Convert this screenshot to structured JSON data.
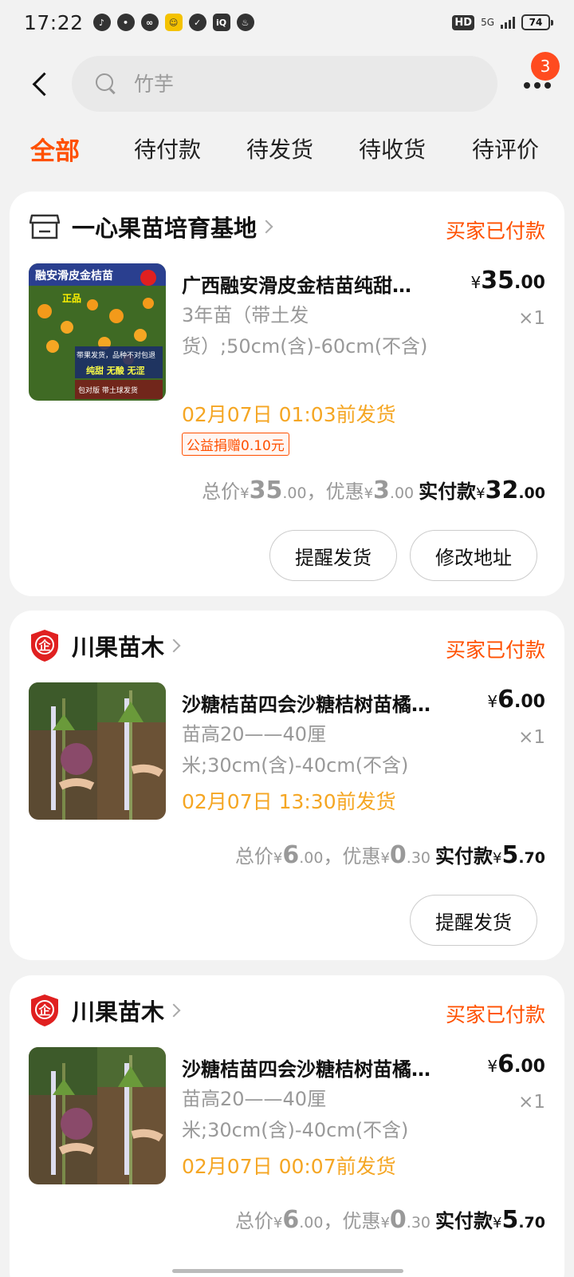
{
  "status_bar": {
    "time": "17:22",
    "hd": "HD",
    "network": "5G",
    "battery": "74"
  },
  "search": {
    "placeholder": "竹芋"
  },
  "more_badge": "3",
  "tabs": [
    "全部",
    "待付款",
    "待发货",
    "待收货",
    "待评价"
  ],
  "active_tab": "全部",
  "orders": [
    {
      "shop": "一心果苗培育基地",
      "status": "买家已付款",
      "title": "广西融安滑皮金桔苗纯甜…",
      "price_int": "35",
      "price_dec": ".00",
      "qty": "×1",
      "spec": "3年苗（带土发货）;50cm(含)-60cm(不含)",
      "ship": "02月07日 01:03前发货",
      "tag": "公益捐赠0.10元",
      "sum_total_label": "总价",
      "sum_total_int": "35",
      "sum_total_dec": ".00",
      "sum_discount_label": "，优惠",
      "sum_discount_int": "3",
      "sum_discount_dec": ".00",
      "sum_paid_label": "实付款",
      "sum_paid_int": "32",
      "sum_paid_dec": ".00",
      "buttons": [
        "提醒发货",
        "修改地址"
      ]
    },
    {
      "shop": "川果苗木",
      "status": "买家已付款",
      "title": "沙糖桔苗四会沙糖桔树苗橘…",
      "price_int": "6",
      "price_dec": ".00",
      "qty": "×1",
      "spec": "苗高20——40厘米;30cm(含)-40cm(不含)",
      "ship": "02月07日 13:30前发货",
      "sum_total_label": "总价",
      "sum_total_int": "6",
      "sum_total_dec": ".00",
      "sum_discount_label": "，优惠",
      "sum_discount_int": "0",
      "sum_discount_dec": ".30",
      "sum_paid_label": "实付款",
      "sum_paid_int": "5",
      "sum_paid_dec": ".70",
      "buttons": [
        "提醒发货"
      ]
    },
    {
      "shop": "川果苗木",
      "status": "买家已付款",
      "title": "沙糖桔苗四会沙糖桔树苗橘…",
      "price_int": "6",
      "price_dec": ".00",
      "qty": "×1",
      "spec": "苗高20——40厘米;30cm(含)-40cm(不含)",
      "ship": "02月07日 00:07前发货",
      "sum_total_label": "总价",
      "sum_total_int": "6",
      "sum_total_dec": ".00",
      "sum_discount_label": "，优惠",
      "sum_discount_int": "0",
      "sum_discount_dec": ".30",
      "sum_paid_label": "实付款",
      "sum_paid_int": "5",
      "sum_paid_dec": ".70"
    }
  ],
  "currency": "¥",
  "thumb1_text": {
    "top": "融安滑皮金桔苗",
    "stamp": "正品",
    "l1": "带果发货，品种不对包退",
    "l2": "纯甜 无酸 无涩",
    "l3": "包对版 带土球发货"
  },
  "colors": {
    "accent": "#ff5000",
    "ship": "#f5a623",
    "shop_logo": "#e02020"
  }
}
